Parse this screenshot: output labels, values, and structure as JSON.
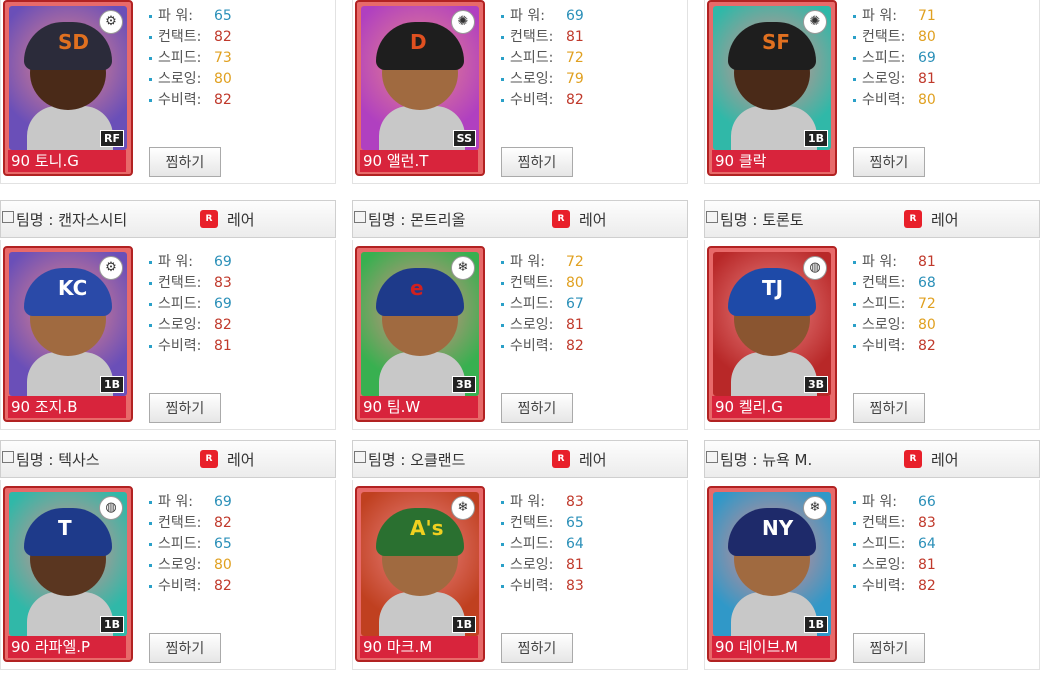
{
  "button_label": "찜하기",
  "rare_label": "레어",
  "rare_badge": "R",
  "stat_labels": [
    "파 워:",
    "컨택트:",
    "스피드:",
    "스로잉:",
    "수비력:"
  ],
  "stat_colors": {
    "blue": "#2a8fb8",
    "red": "#c0392b",
    "orange": "#e0a020"
  },
  "players": [
    {
      "team": "",
      "name": "90 토니.G",
      "pos": "RF",
      "emblem": "gear-icon",
      "bg": "#6a4fb8",
      "helmet": "#2b2b3a",
      "logo": "SD",
      "logo_color": "#e07020",
      "skin": "#4a2a18",
      "stats": [
        {
          "v": "65",
          "c": "blue"
        },
        {
          "v": "82",
          "c": "red"
        },
        {
          "v": "73",
          "c": "orange"
        },
        {
          "v": "80",
          "c": "orange"
        },
        {
          "v": "82",
          "c": "red"
        }
      ]
    },
    {
      "team": "",
      "name": "90 앨런.T",
      "pos": "SS",
      "emblem": "sun-icon",
      "bg": "#b040c0",
      "helmet": "#1e1e1e",
      "logo": "D",
      "logo_color": "#e05020",
      "skin": "#a06a40",
      "stats": [
        {
          "v": "69",
          "c": "blue"
        },
        {
          "v": "81",
          "c": "red"
        },
        {
          "v": "72",
          "c": "orange"
        },
        {
          "v": "79",
          "c": "orange"
        },
        {
          "v": "82",
          "c": "red"
        }
      ]
    },
    {
      "team": "",
      "name": "90 클락",
      "pos": "1B",
      "emblem": "sun-icon",
      "bg": "#30b8a8",
      "helmet": "#1e1e1e",
      "logo": "SF",
      "logo_color": "#e07020",
      "skin": "#4a2a18",
      "stats": [
        {
          "v": "71",
          "c": "orange"
        },
        {
          "v": "80",
          "c": "orange"
        },
        {
          "v": "69",
          "c": "blue"
        },
        {
          "v": "81",
          "c": "red"
        },
        {
          "v": "80",
          "c": "orange"
        }
      ]
    },
    {
      "team": "팀명 : 캔자스시티",
      "name": "90 조지.B",
      "pos": "1B",
      "emblem": "gear-icon",
      "bg": "#6a4fb8",
      "helmet": "#2a4aa8",
      "logo": "KC",
      "logo_color": "#ffffff",
      "skin": "#a06a40",
      "stats": [
        {
          "v": "69",
          "c": "blue"
        },
        {
          "v": "83",
          "c": "red"
        },
        {
          "v": "69",
          "c": "blue"
        },
        {
          "v": "82",
          "c": "red"
        },
        {
          "v": "81",
          "c": "red"
        }
      ]
    },
    {
      "team": "팀명 : 몬트리올",
      "name": "90 팀.W",
      "pos": "3B",
      "emblem": "snowflake-icon",
      "bg": "#38b050",
      "helmet": "#1e3a8a",
      "logo": "e",
      "logo_color": "#d02020",
      "skin": "#a06a40",
      "stats": [
        {
          "v": "72",
          "c": "orange"
        },
        {
          "v": "80",
          "c": "orange"
        },
        {
          "v": "67",
          "c": "blue"
        },
        {
          "v": "81",
          "c": "red"
        },
        {
          "v": "82",
          "c": "red"
        }
      ]
    },
    {
      "team": "팀명 : 토론토",
      "name": "90 켈리.G",
      "pos": "3B",
      "emblem": "stone-icon",
      "bg": "#b82828",
      "helmet": "#1e4aa8",
      "logo": "TJ",
      "logo_color": "#ffffff",
      "skin": "#8a5530",
      "stats": [
        {
          "v": "81",
          "c": "red"
        },
        {
          "v": "68",
          "c": "blue"
        },
        {
          "v": "72",
          "c": "orange"
        },
        {
          "v": "80",
          "c": "orange"
        },
        {
          "v": "82",
          "c": "red"
        }
      ]
    },
    {
      "team": "팀명 : 텍사스",
      "name": "90 라파엘.P",
      "pos": "1B",
      "emblem": "stone-icon",
      "bg": "#30b8a8",
      "helmet": "#1e3a8a",
      "logo": "T",
      "logo_color": "#ffffff",
      "skin": "#5a3620",
      "stats": [
        {
          "v": "69",
          "c": "blue"
        },
        {
          "v": "82",
          "c": "red"
        },
        {
          "v": "65",
          "c": "blue"
        },
        {
          "v": "80",
          "c": "orange"
        },
        {
          "v": "82",
          "c": "red"
        }
      ]
    },
    {
      "team": "팀명 : 오클랜드",
      "name": "90 마크.M",
      "pos": "1B",
      "emblem": "snowflake-icon",
      "bg": "#c04020",
      "helmet": "#2a7030",
      "logo": "A's",
      "logo_color": "#f0d020",
      "skin": "#a06a40",
      "stats": [
        {
          "v": "83",
          "c": "red"
        },
        {
          "v": "65",
          "c": "blue"
        },
        {
          "v": "64",
          "c": "blue"
        },
        {
          "v": "81",
          "c": "red"
        },
        {
          "v": "83",
          "c": "red"
        }
      ]
    },
    {
      "team": "팀명 : 뉴욕 M.",
      "name": "90 데이브.M",
      "pos": "1B",
      "emblem": "snowflake-icon",
      "bg": "#3098c8",
      "helmet": "#1e2a6a",
      "logo": "NY",
      "logo_color": "#ffffff",
      "skin": "#a06a40",
      "stats": [
        {
          "v": "66",
          "c": "blue"
        },
        {
          "v": "83",
          "c": "red"
        },
        {
          "v": "64",
          "c": "blue"
        },
        {
          "v": "81",
          "c": "red"
        },
        {
          "v": "82",
          "c": "red"
        }
      ]
    }
  ]
}
